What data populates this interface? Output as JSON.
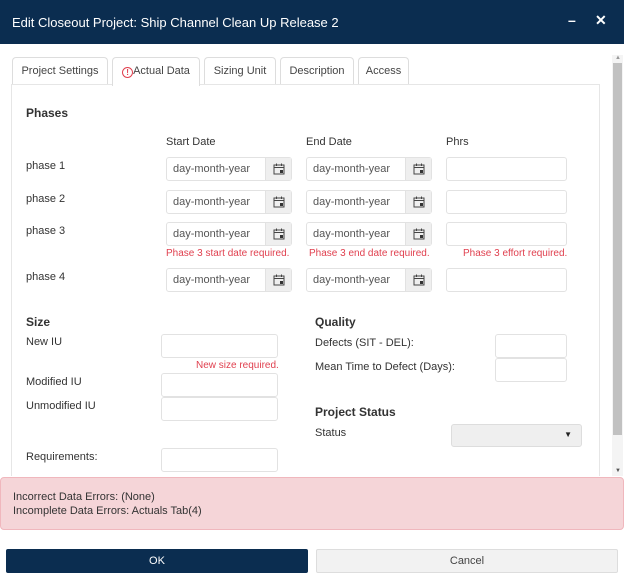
{
  "dialog": {
    "title": "Edit Closeout Project: Ship Channel Clean Up Release 2",
    "minimize": "–",
    "close": "✕"
  },
  "tabs": [
    {
      "label": "Project Settings"
    },
    {
      "label": "Actual Data",
      "warning": "!"
    },
    {
      "label": "Sizing Unit"
    },
    {
      "label": "Description"
    },
    {
      "label": "Access"
    }
  ],
  "phases": {
    "heading": "Phases",
    "columns": {
      "start": "Start Date",
      "end": "End Date",
      "phrs": "Phrs"
    },
    "date_placeholder": "day-month-year",
    "rows": [
      {
        "label": "phase 1"
      },
      {
        "label": "phase 2"
      },
      {
        "label": "phase 3",
        "start_error": "Phase 3 start date required.",
        "end_error": "Phase 3 end date required.",
        "effort_error": "Phase 3 effort required."
      },
      {
        "label": "phase 4"
      }
    ]
  },
  "size": {
    "heading": "Size",
    "new_iu": "New IU",
    "new_iu_error": "New size required.",
    "modified_iu": "Modified IU",
    "unmodified_iu": "Unmodified IU",
    "requirements": "Requirements:"
  },
  "quality": {
    "heading": "Quality",
    "defects": "Defects (SIT - DEL):",
    "mttd": "Mean Time to Defect (Days):"
  },
  "project_status": {
    "heading": "Project Status",
    "status_label": "Status",
    "status_value": ""
  },
  "errors": {
    "incorrect": "Incorrect Data Errors: (None)",
    "incomplete": "Incomplete Data Errors: Actuals Tab(4)"
  },
  "buttons": {
    "ok": "OK",
    "cancel": "Cancel"
  },
  "colors": {
    "header": "#0b2d50",
    "error": "#e0404f",
    "error_bg": "#f5d5d8"
  }
}
